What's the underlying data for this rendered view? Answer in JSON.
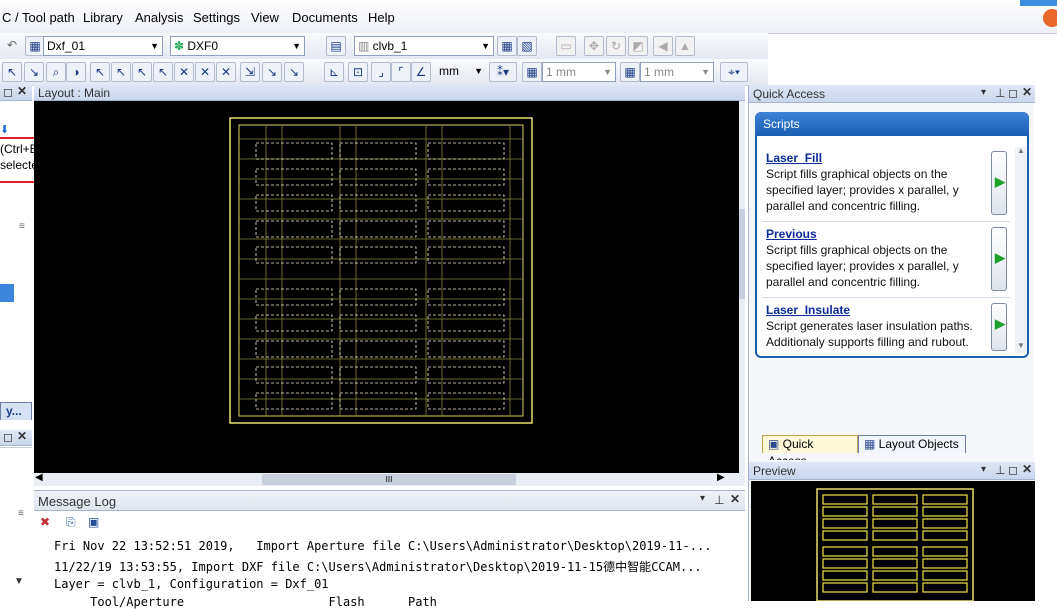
{
  "menubar": {
    "items": [
      "C / Tool path",
      "Library",
      "Analysis",
      "Settings",
      "View",
      "Documents",
      "Help"
    ]
  },
  "toolbar1": {
    "configuration": "Dxf_01",
    "layer_set": "DXF0",
    "layer": "clvb_1"
  },
  "toolbar2": {
    "unit": "mm",
    "grid_x": "1 mm",
    "grid_y": "1 mm"
  },
  "left_panel": {
    "tooltip_line1": "(Ctrl+Enter)",
    "tooltip_line2": "selected jobs",
    "tab_label": "y..."
  },
  "layout": {
    "title": "Layout : Main",
    "scroll_thumb": "III"
  },
  "quick_access": {
    "title": "Quick Access",
    "section": "Scripts",
    "scripts": [
      {
        "name": "Laser_Fill",
        "description": "Script fills graphical objects on the specified layer; provides x parallel, y parallel and concentric filling."
      },
      {
        "name": "Previous",
        "description": "Script fills graphical objects on the specified layer; provides x parallel, y parallel and concentric filling."
      },
      {
        "name": "Laser_Insulate",
        "description": "Script generates laser insulation paths. Additionaly supports filling and rubout."
      }
    ],
    "tabs": [
      "Quick Access",
      "Layout Objects"
    ]
  },
  "preview": {
    "title": "Preview"
  },
  "message_log": {
    "title": "Message Log",
    "lines": [
      "Fri Nov 22 13:52:51 2019,   Import Aperture file C:\\Users\\Administrator\\Desktop\\2019-11-...",
      "11/22/19 13:53:55, Import DXF file C:\\Users\\Administrator\\Desktop\\2019-11-15德中智能CCAM...",
      "Layer = clvb_1, Configuration = Dxf_01",
      "     Tool/Aperture                    Flash      Path"
    ]
  },
  "colors": {
    "canvas": "#000000",
    "pcb_outline": "#e8e070",
    "highlight_box": "#e0202a",
    "panel_blue": "#1a5fb0"
  }
}
